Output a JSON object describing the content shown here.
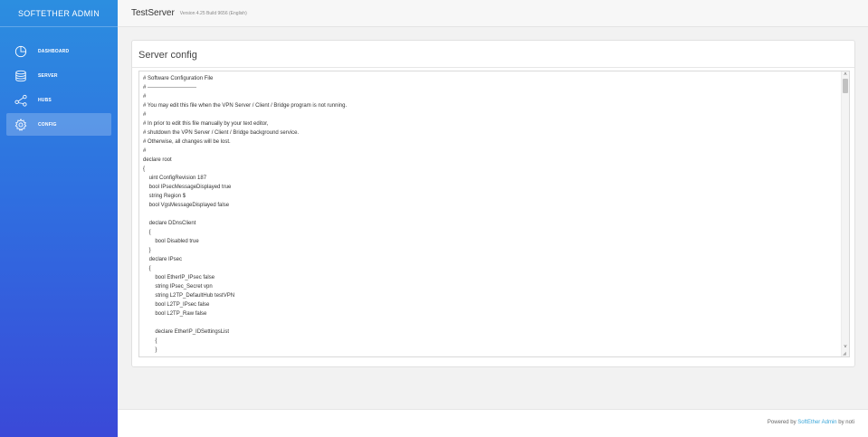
{
  "sidebar": {
    "brand": "SOFTETHER ADMIN",
    "items": [
      {
        "label": "DASHBOARD",
        "icon": "pie-chart-icon",
        "active": false
      },
      {
        "label": "SERVER",
        "icon": "database-icon",
        "active": false
      },
      {
        "label": "HUBS",
        "icon": "share-icon",
        "active": false
      },
      {
        "label": "CONFIG",
        "icon": "gear-icon",
        "active": true
      }
    ]
  },
  "header": {
    "server_name": "TestServer",
    "version": "Version 4.25 Build 9656 (English)"
  },
  "card": {
    "title": "Server config"
  },
  "config": {
    "lines": [
      "# Software Configuration File",
      "# ---------------------------",
      "#",
      "# You may edit this file when the VPN Server / Client / Bridge program is not running.",
      "#",
      "# In prior to edit this file manually by your text editor,",
      "# shutdown the VPN Server / Client / Bridge background service.",
      "# Otherwise, all changes will be lost.",
      "#",
      "declare root",
      "{",
      "\tuint ConfigRevision 187",
      "\tbool IPsecMessageDisplayed true",
      "\tstring Region $",
      "\tbool VgsMessageDisplayed false",
      "",
      "\tdeclare DDnsClient",
      "\t{",
      "\t\tbool Disabled true",
      "\t}",
      "\tdeclare IPsec",
      "\t{",
      "\t\tbool EtherIP_IPsec false",
      "\t\tstring IPsec_Secret vpn",
      "\t\tstring L2TP_DefaultHub testVPN",
      "\t\tbool L2TP_IPsec false",
      "\t\tbool L2TP_Raw false",
      "",
      "\t\tdeclare EtherIP_IDSettingsList",
      "\t\t{",
      "\t\t}"
    ],
    "scroll_up_glyph": "˄",
    "scroll_down_glyph": "˅",
    "resize_glyph": "◢"
  },
  "footer": {
    "prefix": "Powered by ",
    "link": "SoftEther Admin",
    "suffix": " by noti"
  },
  "colors": {
    "sidebar_top": "#2c8ee0",
    "sidebar_bottom": "#3a49d8",
    "link": "#3aa6d8"
  }
}
